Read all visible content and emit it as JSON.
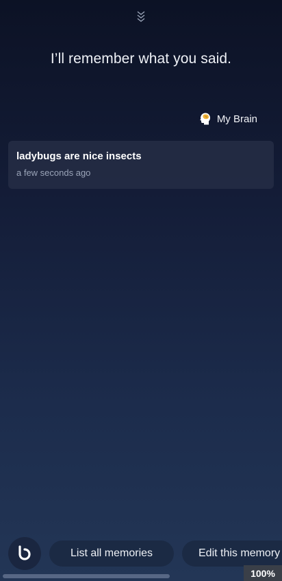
{
  "header": {
    "collapse_icon": "double-chevron-down-icon"
  },
  "main": {
    "headline": "I’ll remember what you said.",
    "brain_link": {
      "label": "My Brain",
      "icon": "brain-head-icon"
    },
    "memory": {
      "text": "ladybugs are nice insects",
      "time": "a few seconds ago"
    }
  },
  "bottom_bar": {
    "bixby_icon": "bixby-logo-icon",
    "suggestions": [
      "List all memories",
      "Edit this memory"
    ]
  },
  "status": {
    "zoom": "100%"
  },
  "colors": {
    "background_top": "#0c1225",
    "background_bottom": "#233656",
    "card": "#283048",
    "chip": "#1b2a44",
    "secondary_text": "#9aa4b8"
  }
}
